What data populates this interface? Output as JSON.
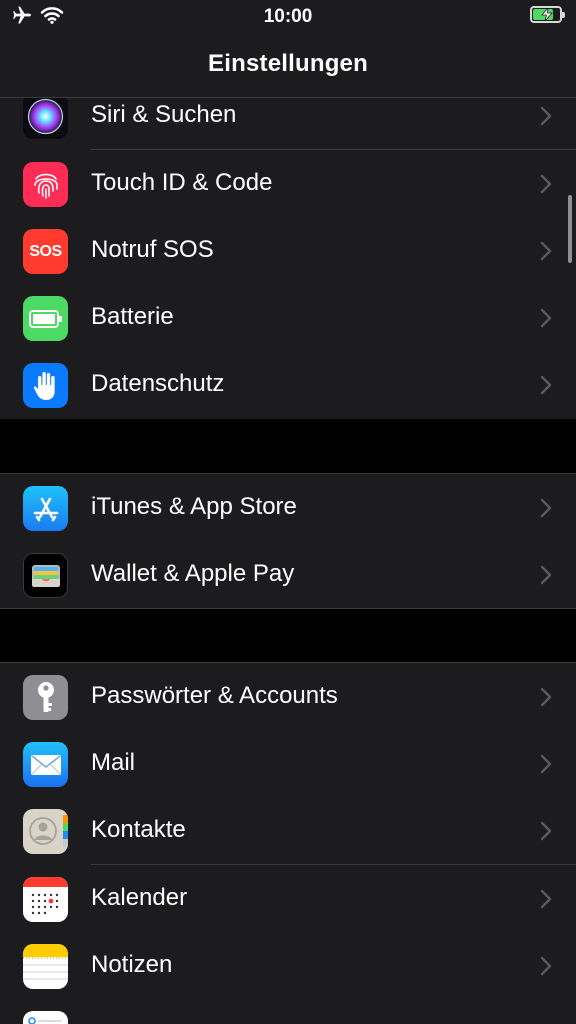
{
  "status_bar": {
    "time": "10:00",
    "left_icons": [
      "airplane-icon",
      "wifi-icon"
    ],
    "battery": {
      "level": 0.75,
      "charging": true,
      "color": "#4cd964"
    }
  },
  "nav": {
    "title": "Einstellungen"
  },
  "groups": [
    {
      "items": [
        {
          "label": "Siri & Suchen",
          "icon": "siri-icon"
        },
        {
          "label": "Touch ID & Code",
          "icon": "fingerprint-icon",
          "color": "#ff2d55"
        },
        {
          "label": "Notruf SOS",
          "icon": "sos-icon",
          "icon_text": "SOS",
          "color": "#ff3b30"
        },
        {
          "label": "Batterie",
          "icon": "battery-icon",
          "color": "#4cd964"
        },
        {
          "label": "Datenschutz",
          "icon": "hand-icon",
          "color": "#0a7aff"
        }
      ]
    },
    {
      "items": [
        {
          "label": "iTunes & App Store",
          "icon": "app-store-icon",
          "color": "#1a9bf0"
        },
        {
          "label": "Wallet & Apple Pay",
          "icon": "wallet-icon",
          "color": "#000000"
        }
      ]
    },
    {
      "items": [
        {
          "label": "Passwörter & Accounts",
          "icon": "key-icon",
          "color": "#8e8e93"
        },
        {
          "label": "Mail",
          "icon": "mail-icon",
          "color": "#1e8df5"
        },
        {
          "label": "Kontakte",
          "icon": "contacts-icon",
          "color": "#d9d4c7"
        },
        {
          "label": "Kalender",
          "icon": "calendar-icon",
          "color": "#ffffff"
        },
        {
          "label": "Notizen",
          "icon": "notes-icon",
          "color": "#ffffff"
        },
        {
          "label": "",
          "icon": "reminders-icon",
          "color": "#ffffff"
        }
      ]
    }
  ]
}
